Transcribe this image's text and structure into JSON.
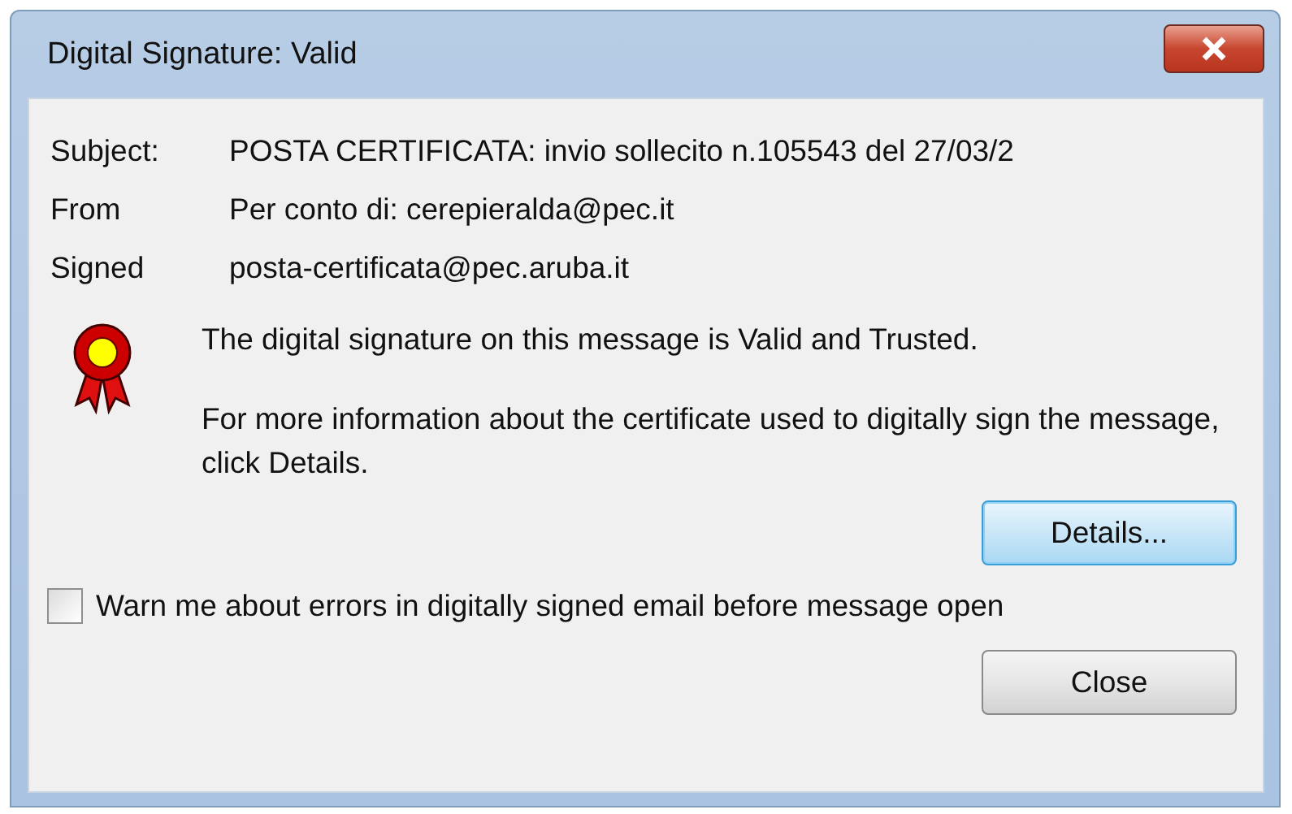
{
  "window": {
    "title": "Digital Signature: Valid"
  },
  "fields": [
    {
      "label": "Subject:",
      "value": "POSTA CERTIFICATA: invio sollecito n.105543 del 27/03/2"
    },
    {
      "label": "From",
      "value": "Per conto di: cerepieralda@pec.it"
    },
    {
      "label": "Signed",
      "value": "posta-certificata@pec.aruba.it"
    }
  ],
  "status_message": "The digital signature on this message is Valid and Trusted.",
  "info_message": "For more information about the certificate used to digitally sign the message, click Details.",
  "details_button": {
    "label": "Details...",
    "focused": true
  },
  "warn_checkbox": {
    "label": "Warn me about errors in digitally signed email before message open",
    "checked": false
  },
  "close_button": {
    "label": "Close"
  }
}
